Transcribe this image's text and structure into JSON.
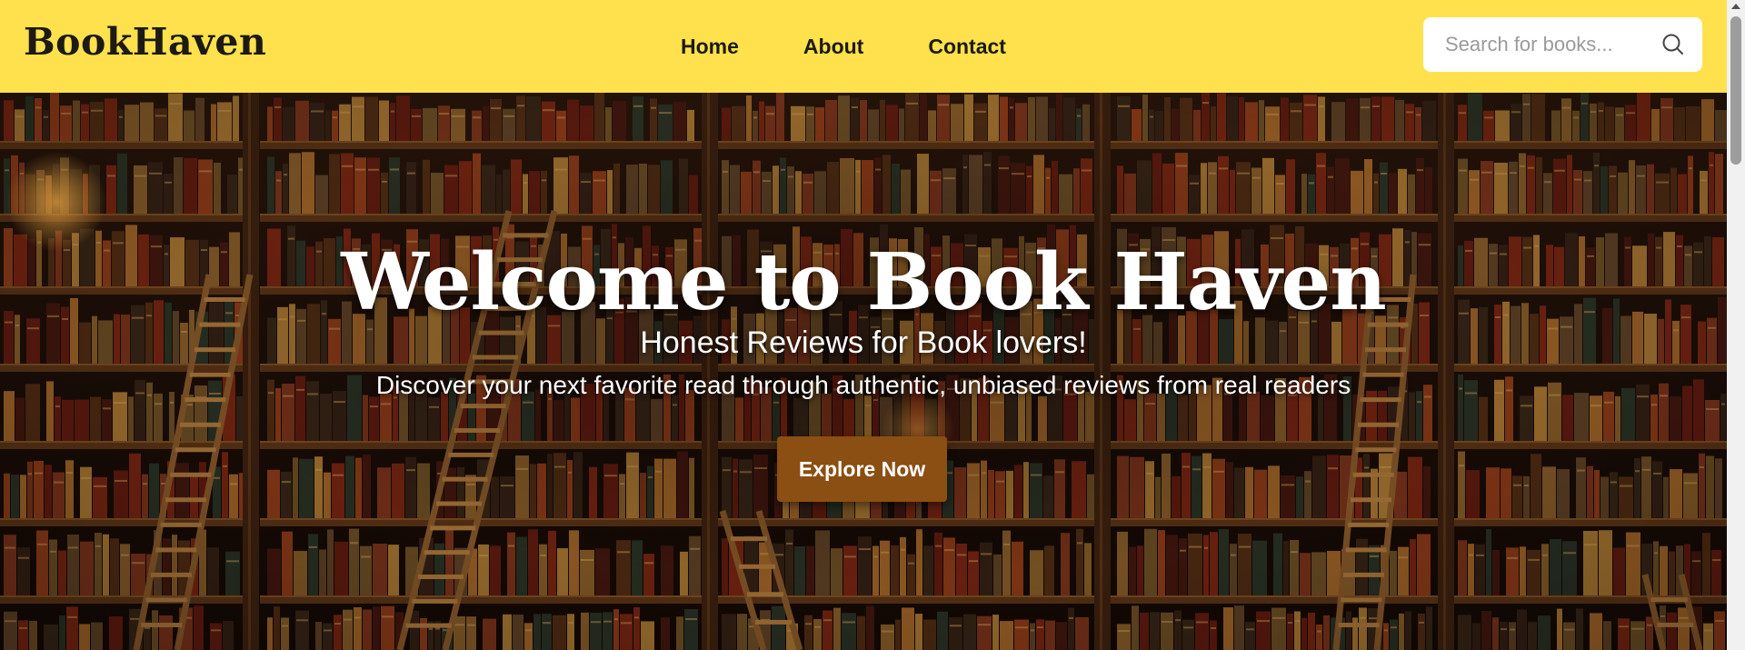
{
  "header": {
    "logo": "BookHaven",
    "nav": [
      {
        "label": "Home"
      },
      {
        "label": "About"
      },
      {
        "label": "Contact"
      }
    ],
    "search": {
      "placeholder": "Search for books...",
      "value": ""
    }
  },
  "hero": {
    "title": "Welcome to Book Haven",
    "subtitle": "Honest Reviews for Book lovers!",
    "tagline": "Discover your next favorite read through authentic, unbiased reviews from real readers",
    "cta_label": "Explore Now",
    "background": "library-bookshelves-image"
  },
  "colors": {
    "header_bg": "#ffe14d",
    "text_dark": "#1c1a12",
    "cta_bg": "#8b4f13",
    "hero_text": "#ffffff"
  },
  "icons": {
    "search": "search-icon"
  }
}
